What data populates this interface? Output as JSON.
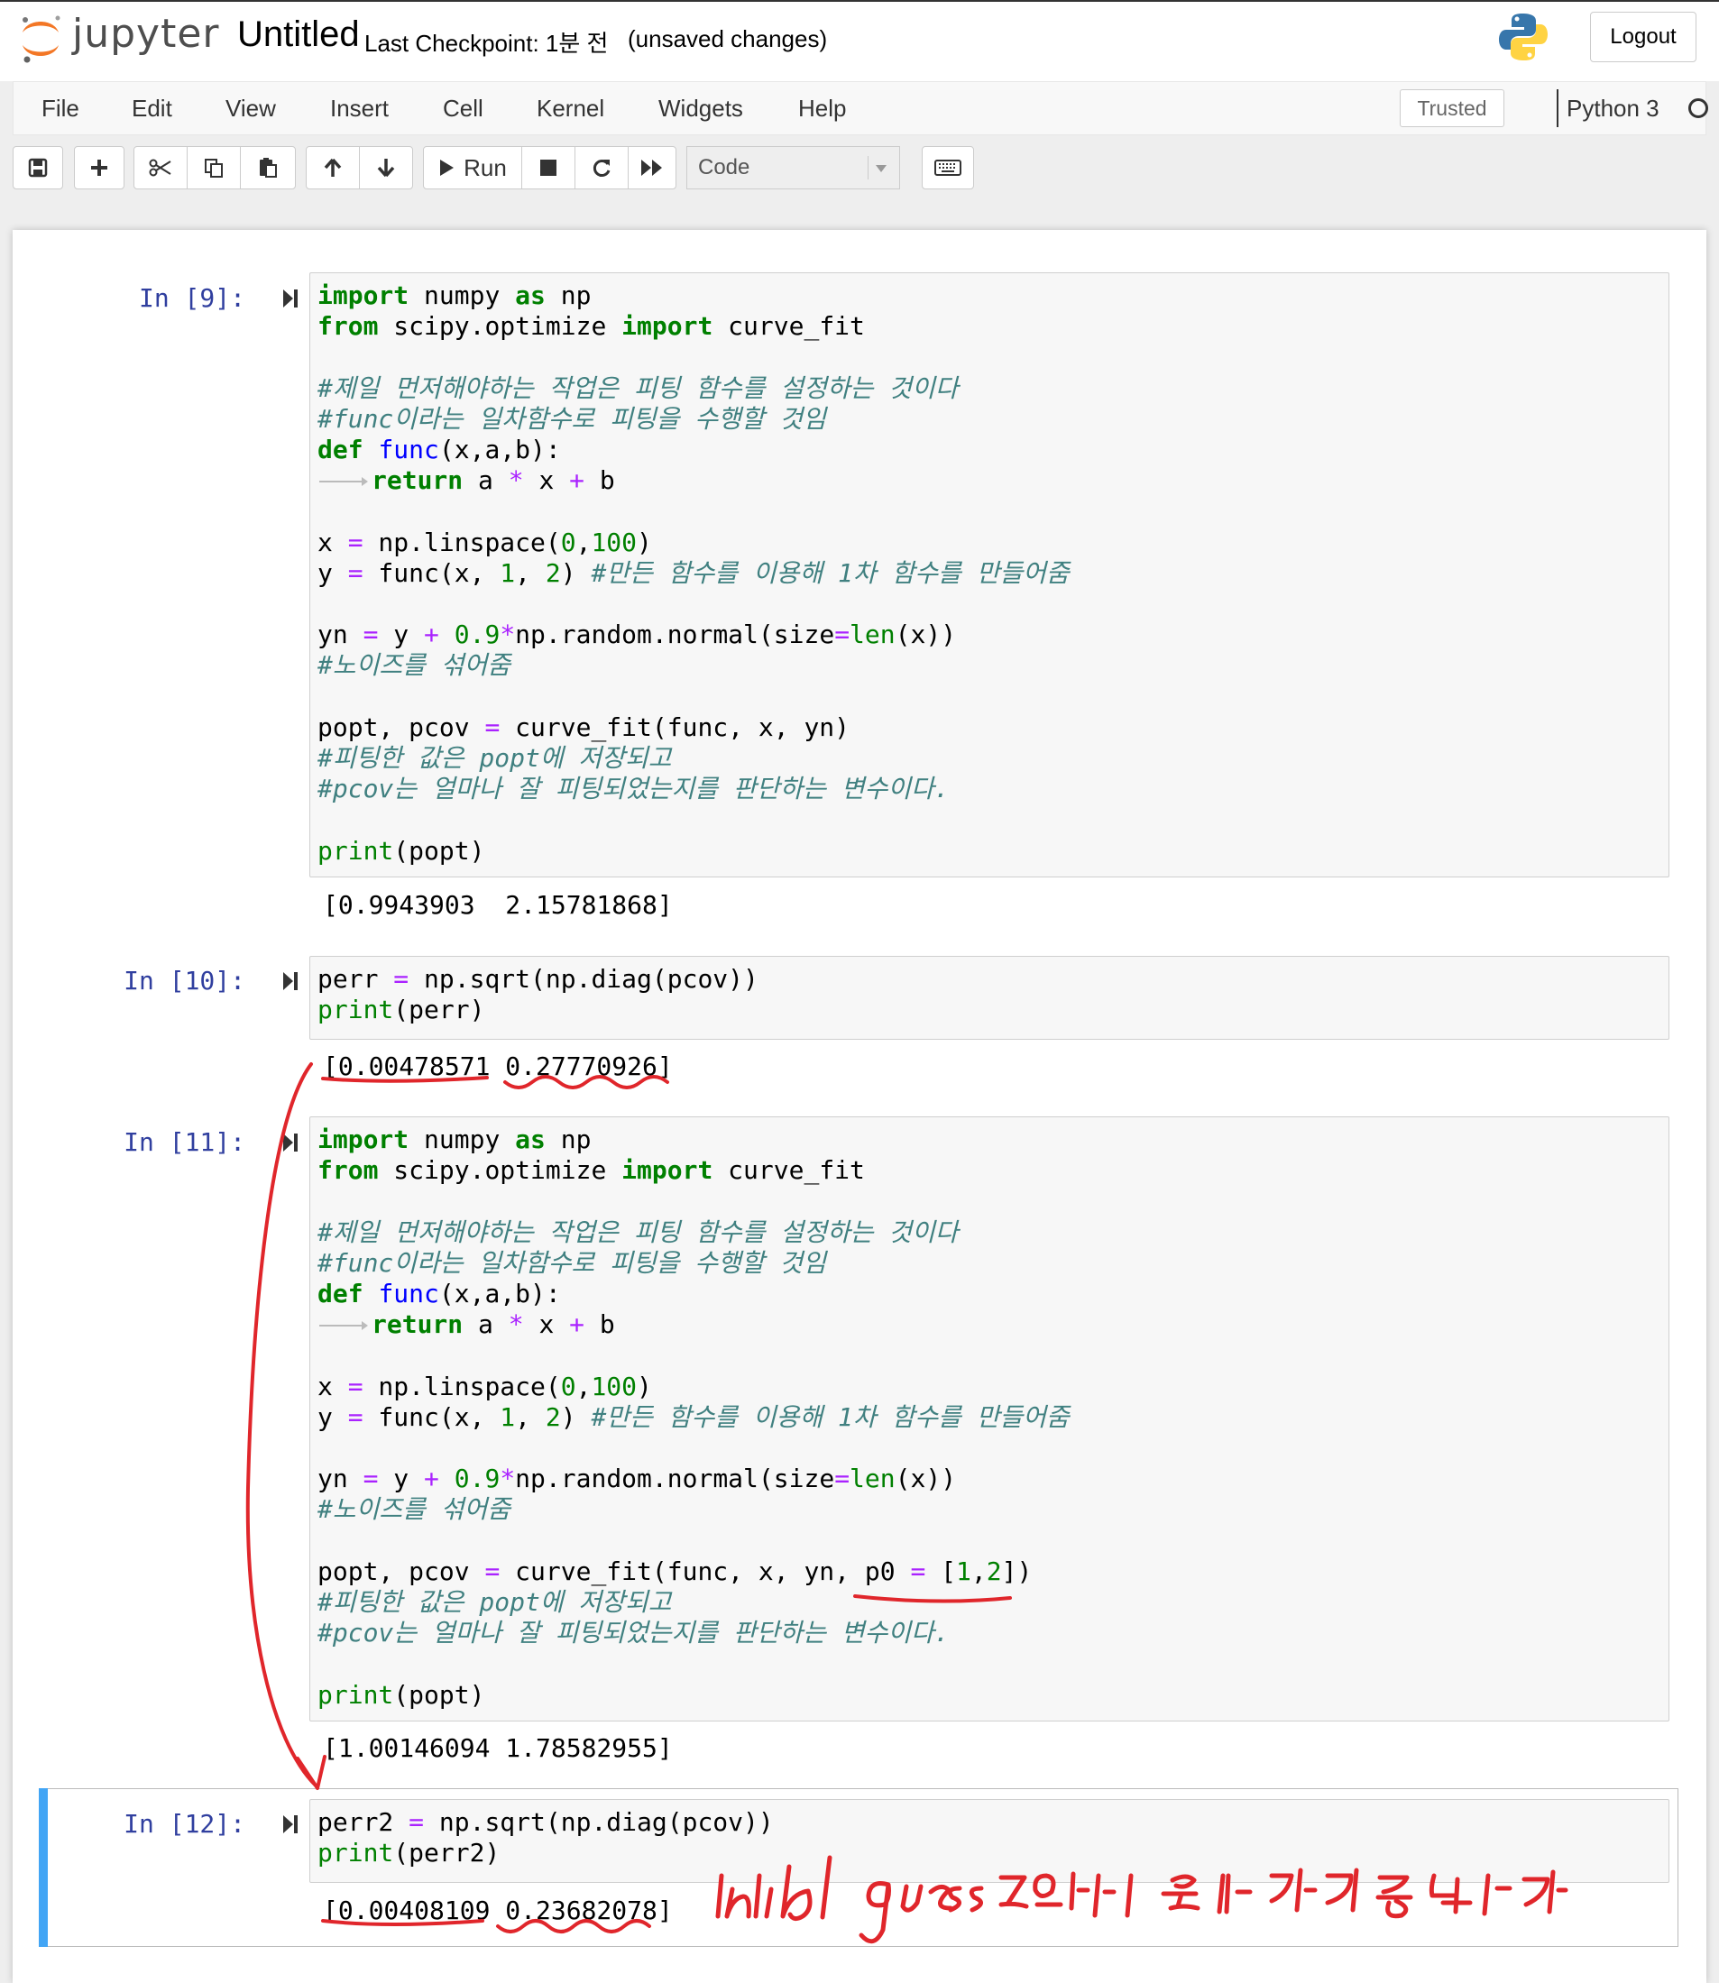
{
  "header": {
    "brand": "jupyter",
    "notebook_title": "Untitled",
    "checkpoint": "Last Checkpoint: 1분 전",
    "unsaved": "(unsaved changes)",
    "logout_label": "Logout"
  },
  "menubar": {
    "items": [
      "File",
      "Edit",
      "View",
      "Insert",
      "Cell",
      "Kernel",
      "Widgets",
      "Help"
    ],
    "trusted": "Trusted",
    "kernel_name": "Python 3"
  },
  "toolbar": {
    "run_label": "Run",
    "cell_type": "Code",
    "icons": [
      "save-icon",
      "plus-icon",
      "cut-icon",
      "copy-icon",
      "paste-icon",
      "arrow-up-icon",
      "arrow-down-icon",
      "play-icon",
      "stop-icon",
      "restart-icon",
      "fast-forward-icon",
      "keyboard-icon"
    ]
  },
  "cells": [
    {
      "prompt": "In [9]:",
      "code_lines": [
        "import numpy as np",
        "from scipy.optimize import curve_fit",
        "",
        "#제일 먼저해야하는 작업은 피팅 함수를 설정하는 것이다",
        "#func이라는 일차함수로 피팅을 수행할 것임",
        "def func(x,a,b):",
        "    return a * x + b",
        "",
        "x = np.linspace(0,100)",
        "y = func(x, 1, 2) #만든 함수를 이용해 1차 함수를 만들어줌",
        "",
        "yn = y + 0.9*np.random.normal(size=len(x))",
        "#노이즈를 섞어줌",
        "",
        "popt, pcov = curve_fit(func, x, yn)",
        "#피팅한 값은 popt에 저장되고",
        "#pcov는 얼마나 잘 피팅되었는지를 판단하는 변수이다.",
        "",
        "print(popt)"
      ],
      "output": "[0.9943903  2.15781868]"
    },
    {
      "prompt": "In [10]:",
      "code_lines": [
        "perr = np.sqrt(np.diag(pcov))",
        "print(perr)"
      ],
      "output": "[0.00478571 0.27770926]"
    },
    {
      "prompt": "In [11]:",
      "code_lines": [
        "import numpy as np",
        "from scipy.optimize import curve_fit",
        "",
        "#제일 먼저해야하는 작업은 피팅 함수를 설정하는 것이다",
        "#func이라는 일차함수로 피팅을 수행할 것임",
        "def func(x,a,b):",
        "    return a * x + b",
        "",
        "x = np.linspace(0,100)",
        "y = func(x, 1, 2) #만든 함수를 이용해 1차 함수를 만들어줌",
        "",
        "yn = y + 0.9*np.random.normal(size=len(x))",
        "#노이즈를 섞어줌",
        "",
        "popt, pcov = curve_fit(func, x, yn, p0 = [1,2])",
        "#피팅한 값은 popt에 저장되고",
        "#pcov는 얼마나 잘 피팅되었는지를 판단하는 변수이다.",
        "",
        "print(popt)"
      ],
      "output": "[1.00146094 1.78582955]"
    },
    {
      "prompt": "In [12]:",
      "code_lines": [
        "perr2 = np.sqrt(np.diag(pcov))",
        "print(perr2)"
      ],
      "output": "[0.00408109 0.23682078]"
    }
  ],
  "annotation": {
    "handwritten_note": "initial guess로 인해 오차가 조금 줄었다",
    "ink_color": "#e0262b"
  }
}
